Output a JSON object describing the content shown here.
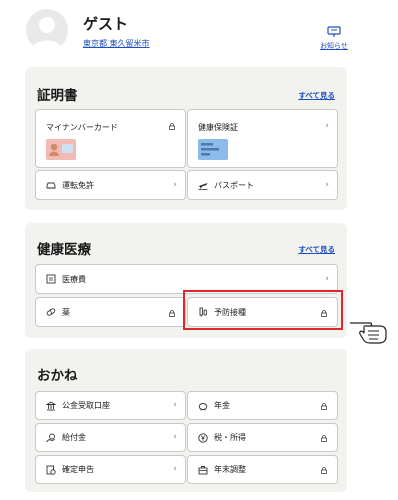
{
  "user": {
    "name": "ゲスト",
    "location": "東京都 東久留米市"
  },
  "notifications": {
    "label": "お知らせ"
  },
  "sections": {
    "certificates": {
      "title": "証明書",
      "see_all": "すべて見る",
      "my_number_card": "マイナンバーカード",
      "health_insurance": "健康保険証",
      "drivers_license": "運転免許",
      "passport": "パスポート"
    },
    "health": {
      "title": "健康医療",
      "see_all": "すべて見る",
      "medical_expenses": "医療費",
      "medicine": "薬",
      "vaccination": "予防接種"
    },
    "money": {
      "title": "おかね",
      "public_account": "公金受取口座",
      "pension": "年金",
      "benefits": "給付金",
      "tax_income": "税・所得",
      "tax_return": "確定申告",
      "year_end_adjustment": "年末調整"
    }
  },
  "colors": {
    "link": "#1b4fbf",
    "highlight": "#e0262b",
    "section_bg": "#f2f2ef"
  },
  "icons": [
    "avatar-icon",
    "notification-icon",
    "lock-icon",
    "chevron-right-icon",
    "car-icon",
    "airplane-icon",
    "receipt-icon",
    "pill-icon",
    "syringe-icon",
    "bank-icon",
    "piggy-bank-icon",
    "benefits-icon",
    "yen-coin-icon",
    "tax-return-icon",
    "briefcase-icon",
    "pointing-hand-icon"
  ]
}
